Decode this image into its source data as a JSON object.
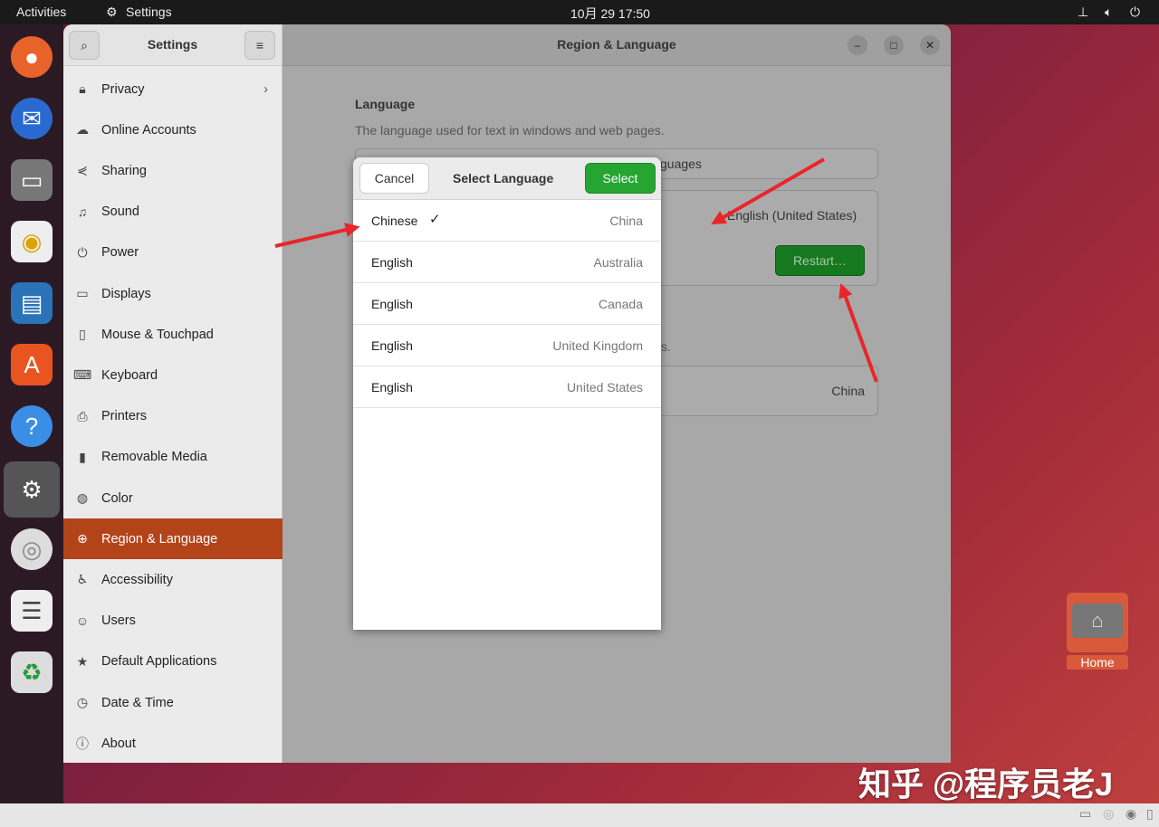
{
  "topbar": {
    "activities": "Activities",
    "app": "Settings",
    "clock": "10月 29  17:50"
  },
  "dock": {
    "apps": [
      "firefox",
      "thunderbird",
      "files",
      "rhythmbox",
      "writer",
      "app-center",
      "help",
      "settings",
      "disc",
      "text-editor",
      "trash"
    ]
  },
  "window": {
    "sidebar_title": "Settings",
    "title": "Region & Language",
    "items": [
      {
        "label": "Privacy",
        "icon": "lock-icon"
      },
      {
        "label": "Online Accounts",
        "icon": "cloud-icon"
      },
      {
        "label": "Sharing",
        "icon": "share-icon"
      },
      {
        "label": "Sound",
        "icon": "music-icon"
      },
      {
        "label": "Power",
        "icon": "power-icon"
      },
      {
        "label": "Displays",
        "icon": "display-icon"
      },
      {
        "label": "Mouse & Touchpad",
        "icon": "mouse-icon"
      },
      {
        "label": "Keyboard",
        "icon": "keyboard-icon"
      },
      {
        "label": "Printers",
        "icon": "printer-icon"
      },
      {
        "label": "Removable Media",
        "icon": "usb-icon"
      },
      {
        "label": "Color",
        "icon": "color-icon"
      },
      {
        "label": "Region & Language",
        "icon": "globe-icon",
        "selected": true
      },
      {
        "label": "Accessibility",
        "icon": "accessibility-icon"
      },
      {
        "label": "Users",
        "icon": "users-icon"
      },
      {
        "label": "Default Applications",
        "icon": "star-icon"
      },
      {
        "label": "Date & Time",
        "icon": "clock-icon"
      },
      {
        "label": "About",
        "icon": "info-icon"
      }
    ],
    "main": {
      "language_heading": "Language",
      "language_desc": "The language used for text in windows and web pages.",
      "manage_fragment": "guages",
      "language_value": "English (United States)",
      "restart": "Restart…",
      "formats_fragment": "s.",
      "formats_value": "China"
    }
  },
  "dialog": {
    "cancel": "Cancel",
    "title": "Select Language",
    "select": "Select",
    "rows": [
      {
        "language": "Chinese",
        "region": "China",
        "checked": true
      },
      {
        "language": "English",
        "region": "Australia"
      },
      {
        "language": "English",
        "region": "Canada"
      },
      {
        "language": "English",
        "region": "United Kingdom"
      },
      {
        "language": "English",
        "region": "United States"
      }
    ]
  },
  "desktop": {
    "home_label": "Home"
  },
  "watermark": "知乎 @程序员老J"
}
